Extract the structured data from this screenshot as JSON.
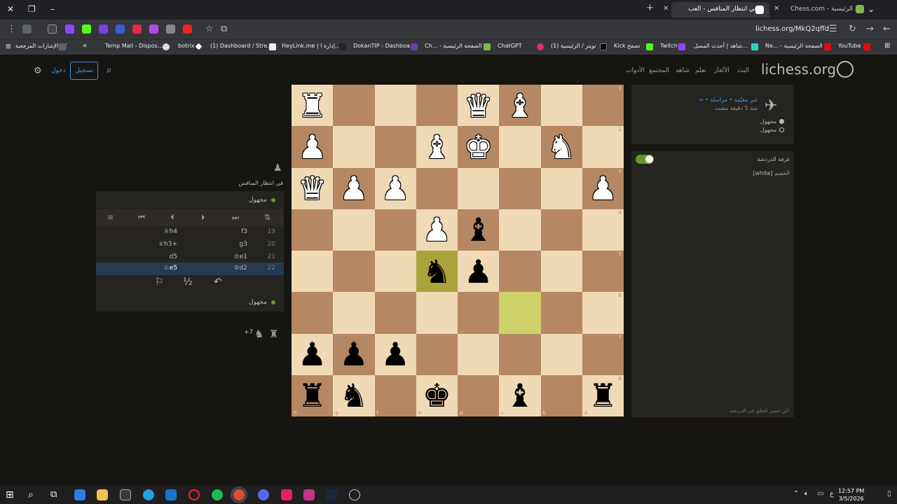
{
  "browser": {
    "tabs": [
      {
        "title": "Chess.com - الصفحة الرئيسية"
      },
      {
        "title": "في انتظار المنافس - العب..."
      }
    ],
    "url": "lichess.org/MkQ2qffd",
    "bookmarks": [
      "كل الإشارات المرجعية",
      "Temp Mail - Dispos...",
      "botrix",
      "(1) Dashboard / Stre...",
      "HeyLink.me | إدارة ا...",
      "DokanTIP - Dashboa...",
      "Ch... - الصفحة الرئيسية",
      "ChatGPT",
      "(1) تويتر / الرئيسية",
      "Kick تصفح",
      "Twitch",
      "شاهد | أحدث المسل...",
      "Ne... - الصفحة الرئيسية",
      "YouTube"
    ]
  },
  "site": {
    "logo": "lichess.org",
    "nav": [
      "البث",
      "الألغاز",
      "تعلم",
      "شاهد",
      "المجتمع",
      "الأدوات"
    ],
    "signin": "تسجيل",
    "register": "دخول"
  },
  "board": {
    "files_bottom": [
      "h",
      "g",
      "f",
      "e",
      "d",
      "c",
      "b",
      "a"
    ],
    "ranks_right": [
      "1",
      "2",
      "3",
      "4",
      "5",
      "6",
      "7",
      "8"
    ],
    "squares": [
      [
        "R",
        "",
        "",
        "",
        "Q",
        "B",
        "",
        ""
      ],
      [
        "P",
        "",
        "",
        "B",
        "K",
        "",
        "N",
        ""
      ],
      [
        "Q",
        "P",
        "P",
        "",
        "",
        "",
        "",
        "P"
      ],
      [
        "",
        "",
        "",
        "P",
        "b",
        "",
        "",
        ""
      ],
      [
        "",
        "",
        "",
        "n",
        "p",
        "",
        "",
        ""
      ],
      [
        "",
        "",
        "",
        "",
        "",
        "",
        "",
        ""
      ],
      [
        "p",
        "p",
        "p",
        "",
        "",
        "",
        "",
        ""
      ],
      [
        "r",
        "n",
        "",
        "k",
        "",
        "b",
        "",
        "r"
      ]
    ],
    "note_pieces": "Uppercase = white piece, lowercase = black piece; Q on rank 3 file a-column shown black-crowned queen image with white fill"
  },
  "game": {
    "opponent_label": "في انتظار المنافس",
    "top_player": "مجهول",
    "bottom_player": "مجهول",
    "moves": [
      {
        "num": "19",
        "white": "f3",
        "black": "♕h4"
      },
      {
        "num": "20",
        "white": "g3",
        "black": "♕h3+"
      },
      {
        "num": "21",
        "white": "♔e1",
        "black": "d5"
      },
      {
        "num": "22",
        "white": "♔d2",
        "black": "♘e5"
      }
    ],
    "material_diff": "+7",
    "draw_label": "½"
  },
  "right_panel": {
    "game_desc": "∞ • غير مقيّمة • مراسلة",
    "game_time": "منذ 5 دقيقة مضت",
    "players": [
      "مجهول",
      "مجهول"
    ],
    "chat_title": "غرفة الدردشة",
    "chat_user": "[white]",
    "chat_text": "الخصم",
    "chat_footer": "كن حسن الخلق في الدردشة!"
  },
  "taskbar": {
    "time": "12:57 PM",
    "date": "3/5/2026",
    "lang": "ع"
  }
}
